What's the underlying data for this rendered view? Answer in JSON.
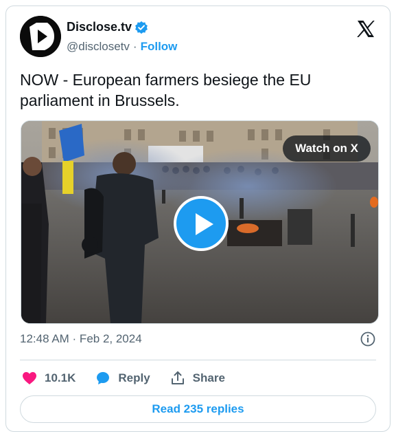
{
  "author": {
    "display_name": "Disclose.tv",
    "handle": "@disclosetv",
    "separator": "·",
    "follow_label": "Follow",
    "avatar_icon": "disclosetv-logo",
    "verified_icon": "verified-badge-icon"
  },
  "platform_icon": "x-logo",
  "tweet": {
    "text": "NOW - European farmers besiege the EU parliament in Brussels."
  },
  "media": {
    "watch_label": "Watch on X",
    "play_icon": "play-icon"
  },
  "meta": {
    "timestamp": "12:48 AM · Feb 2, 2024",
    "info_icon": "info-icon"
  },
  "actions": {
    "like_count": "10.1K",
    "reply_label": "Reply",
    "share_label": "Share"
  },
  "footer": {
    "read_replies_label": "Read 235 replies"
  },
  "colors": {
    "accent": "#1d9bf0",
    "like": "#f91880",
    "text_primary": "#0f1419",
    "text_secondary": "#536471",
    "border": "#cfd9de"
  }
}
